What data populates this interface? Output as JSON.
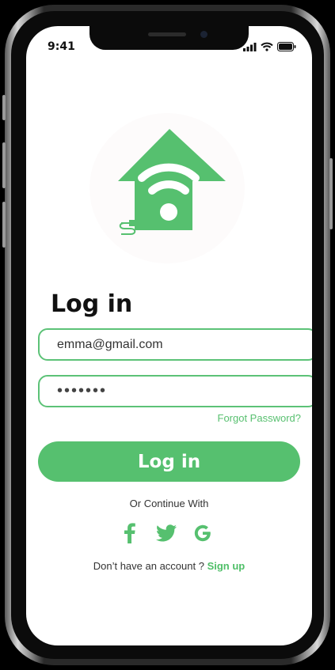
{
  "status_bar": {
    "time": "9:41"
  },
  "login": {
    "title": "Log in",
    "email_value": "emma@gmail.com",
    "password_value": "•••••••",
    "forgot_password": "Forgot Password?",
    "submit_label": "Log in",
    "continue_with": "Or Continue With",
    "socials": [
      "facebook-icon",
      "twitter-icon",
      "google-icon"
    ],
    "no_account": "Don’t have an account ?",
    "signup_label": "Sign up"
  },
  "colors": {
    "accent": "#56c06f",
    "text": "#111111",
    "background": "#ffffff"
  }
}
